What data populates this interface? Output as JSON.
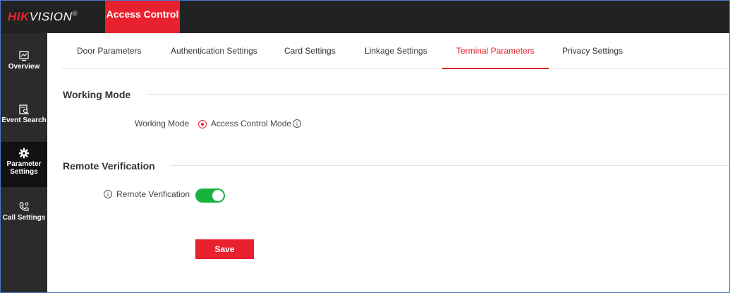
{
  "brand": {
    "logo_red": "HIK",
    "logo_white": "VISION",
    "registered": "®"
  },
  "module": {
    "label": "Access Control"
  },
  "colors": {
    "accent": "#e8212f",
    "toggle_on": "#18b33c",
    "topbar": "#222222",
    "sidebar": "#2b2b2b"
  },
  "sidebar": {
    "items": [
      {
        "label": "Overview",
        "icon": "overview-icon"
      },
      {
        "label": "Event Search",
        "icon": "event-search-icon"
      },
      {
        "label": "Parameter Settings",
        "icon": "gear-icon",
        "active": true
      },
      {
        "label": "Call Settings",
        "icon": "call-settings-icon"
      }
    ]
  },
  "tabs": [
    {
      "label": "Door Parameters"
    },
    {
      "label": "Authentication Settings"
    },
    {
      "label": "Card Settings"
    },
    {
      "label": "Linkage Settings"
    },
    {
      "label": "Terminal Parameters",
      "active": true
    },
    {
      "label": "Privacy Settings"
    }
  ],
  "working_mode": {
    "section_title": "Working Mode",
    "field_label": "Working Mode",
    "option_label": "Access Control Mode",
    "info_glyph": "i"
  },
  "remote_verification": {
    "section_title": "Remote Verification",
    "field_label": "Remote Verification",
    "info_glyph": "i",
    "enabled": true
  },
  "actions": {
    "save_label": "Save"
  }
}
